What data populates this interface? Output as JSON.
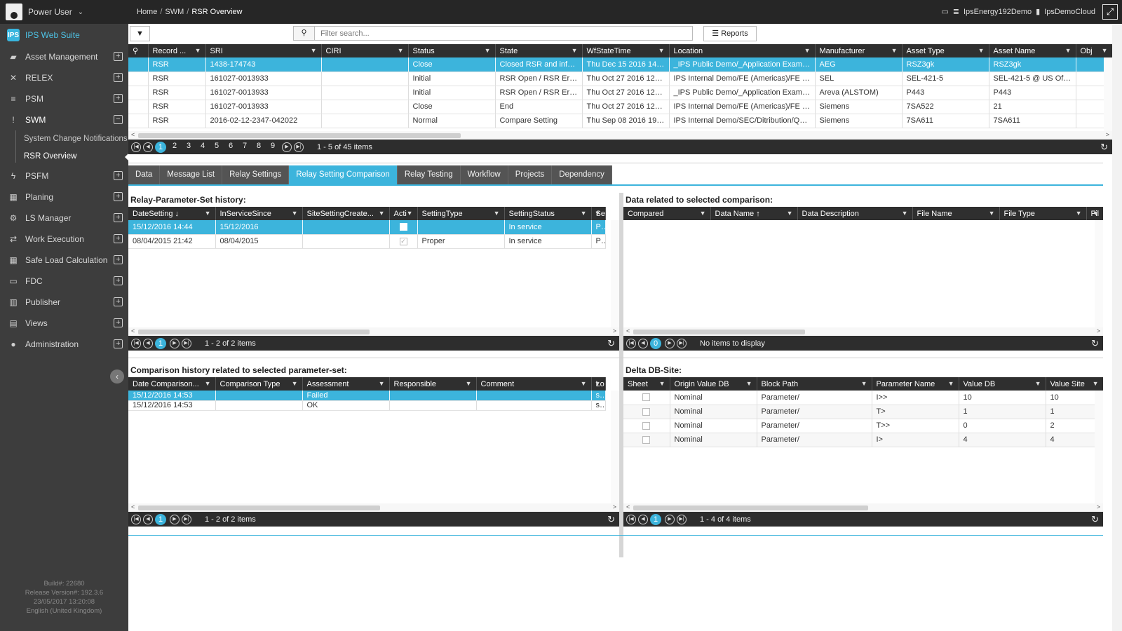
{
  "user": {
    "name": "Power User"
  },
  "brand": {
    "name": "IPS Web Suite",
    "logo_text": "IPS"
  },
  "sidebar": {
    "items": [
      {
        "label": "Asset Management",
        "icon": "folder-open-icon",
        "glyph": "▰"
      },
      {
        "label": "RELEX",
        "icon": "shuffle-icon",
        "glyph": "✕"
      },
      {
        "label": "PSM",
        "icon": "database-icon",
        "glyph": "≡"
      },
      {
        "label": "SWM",
        "icon": "exclamation-icon",
        "glyph": "!"
      },
      {
        "label": "PSFM",
        "icon": "bolt-icon",
        "glyph": "ϟ"
      },
      {
        "label": "Planing",
        "icon": "calendar-icon",
        "glyph": "▦"
      },
      {
        "label": "LS Manager",
        "icon": "cogs-icon",
        "glyph": "⚙"
      },
      {
        "label": "Work Execution",
        "icon": "exchange-icon",
        "glyph": "⇄"
      },
      {
        "label": "Safe Load Calculation",
        "icon": "calculator-icon",
        "glyph": "▦"
      },
      {
        "label": "FDC",
        "icon": "drive-icon",
        "glyph": "▭"
      },
      {
        "label": "Publisher",
        "icon": "bar-chart-icon",
        "glyph": "▥"
      },
      {
        "label": "Views",
        "icon": "window-icon",
        "glyph": "▤"
      },
      {
        "label": "Administration",
        "icon": "user-icon",
        "glyph": "●"
      }
    ],
    "swm_sub": [
      "System Change Notifications",
      "RSR Overview"
    ]
  },
  "build": {
    "line1": "Build#: 22680",
    "line2": "Release Version#: 192.3.6",
    "line3": "23/05/2017 13:20:08",
    "line4": "English (United Kingdom)"
  },
  "breadcrumb": {
    "home": "Home",
    "sep": "/",
    "swm": "SWM",
    "current": "RSR Overview"
  },
  "topright": {
    "env": "IpsEnergy192Demo",
    "cloud": "IpsDemoCloud"
  },
  "toolbar": {
    "search_placeholder": "Filter search...",
    "reports_label": "Reports"
  },
  "rsr_grid": {
    "headers": [
      "Record ...",
      "SRI",
      "CIRI",
      "Status",
      "State",
      "WfStateTime",
      "Location",
      "Manufacturer",
      "Asset Type",
      "Asset Name",
      "Obj"
    ],
    "rows": [
      [
        "RSR",
        "1438-174743",
        "",
        "Close",
        "Closed RSR and infor...",
        "Thu Dec 15 2016 14:5...",
        "_IPS Public Demo/_Application Example...",
        "AEG",
        "RSZ3gk",
        "RSZ3gk"
      ],
      [
        "RSR",
        "161027-0013933",
        "",
        "Initial",
        "RSR Open / RSR Eröf...",
        "Thu Oct 27 2016 12:3...",
        "IPS Internal Demo/FE (Americas)/FE De...",
        "SEL",
        "SEL-421-5",
        "SEL-421-5 @ US Office"
      ],
      [
        "RSR",
        "161027-0013933",
        "",
        "Initial",
        "RSR Open / RSR Eröf...",
        "Thu Oct 27 2016 12:3...",
        "_IPS Public Demo/_Application Example...",
        "Areva (ALSTOM)",
        "P443",
        "P443"
      ],
      [
        "RSR",
        "161027-0013933",
        "",
        "Close",
        "End",
        "Thu Oct 27 2016 12:5...",
        "IPS Internal Demo/FE (Americas)/FE De...",
        "Siemens",
        "7SA522",
        "21"
      ],
      [
        "RSR",
        "2016-02-12-2347-042022",
        "",
        "Normal",
        "Compare Setting",
        "Thu Sep 08 2016 19:2...",
        "IPS Internal Demo/SEC/Ditribution/QUR...",
        "Siemens",
        "7SA611",
        "7SA611"
      ]
    ],
    "pages": [
      "1",
      "2",
      "3",
      "4",
      "5",
      "6",
      "7",
      "8",
      "9"
    ],
    "info": "1 - 5 of 45 items"
  },
  "tabs": [
    "Data",
    "Message List",
    "Relay Settings",
    "Relay Setting Comparison",
    "Relay Testing",
    "Workflow",
    "Projects",
    "Dependency"
  ],
  "history_panel": {
    "title": "Relay-Parameter-Set history:",
    "headers": [
      "DateSetting ↓",
      "InServiceSince",
      "SiteSettingCreate...",
      "Acti",
      "SettingType",
      "SettingStatus",
      "Se"
    ],
    "rows": [
      [
        "15/12/2016 14:44",
        "15/12/2016",
        "",
        "",
        "",
        "In service",
        "Pa"
      ],
      [
        "08/04/2015 21:42",
        "08/04/2015",
        "",
        "",
        "Proper",
        "In service",
        "Pa"
      ]
    ],
    "page": "1",
    "info": "1 - 2 of 2 items"
  },
  "related_panel": {
    "title": "Data related to selected comparison:",
    "headers": [
      "Compared",
      "Data Name ↑",
      "Data Description",
      "File Name",
      "File Type",
      "Fil"
    ],
    "page": "0",
    "info": "No items to display"
  },
  "comparison_panel": {
    "title": "Comparison history related to selected parameter-set:",
    "headers": [
      "Date Comparison...",
      "Comparison Type",
      "Assessment",
      "Responsible",
      "Comment",
      "Lo"
    ],
    "rows": [
      [
        "15/12/2016 14:53",
        "",
        "Failed",
        "",
        "",
        "sg"
      ],
      [
        "15/12/2016 14:53",
        "",
        "OK",
        "",
        "",
        "sg"
      ]
    ],
    "page": "1",
    "info": "1 - 2 of 2 items"
  },
  "delta_panel": {
    "title": "Delta DB-Site:",
    "headers": [
      "Sheet",
      "Origin Value DB",
      "Block Path",
      "Parameter Name",
      "Value DB",
      "Value Site"
    ],
    "rows": [
      [
        "",
        "Nominal",
        "Parameter/",
        "I>>",
        "10",
        "10"
      ],
      [
        "",
        "Nominal",
        "Parameter/",
        "T>",
        "1",
        "1"
      ],
      [
        "",
        "Nominal",
        "Parameter/",
        "T>>",
        "0",
        "2"
      ],
      [
        "",
        "Nominal",
        "Parameter/",
        "I>",
        "4",
        "4"
      ]
    ],
    "page": "1",
    "info": "1 - 4 of 4 items"
  }
}
